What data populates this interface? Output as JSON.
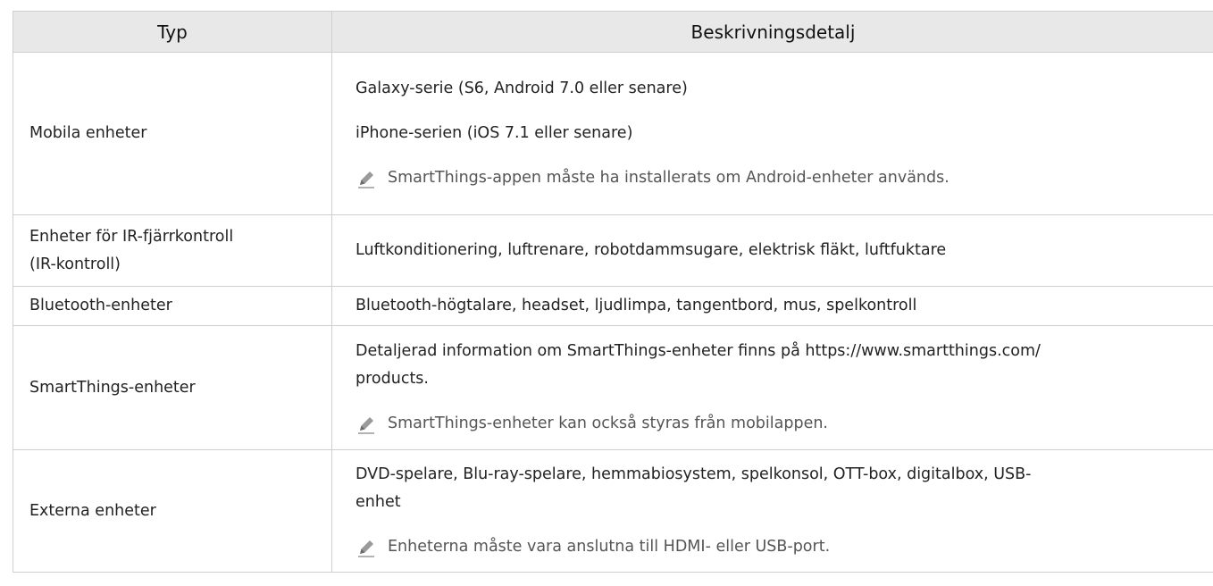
{
  "table": {
    "headers": {
      "type": "Typ",
      "description": "Beskrivningsdetalj"
    },
    "rows": [
      {
        "type": "Mobila enheter",
        "descriptions": [
          "Galaxy-serie (S6, Android 7.0 eller senare)",
          "iPhone-serien (iOS 7.1 eller senare)"
        ],
        "note": "SmartThings-appen måste ha installerats om Android-enheter används."
      },
      {
        "type_lines": [
          "Enheter för IR-fjärrkontroll",
          "(IR-kontroll)"
        ],
        "descriptions": [
          "Luftkonditionering, luftrenare, robotdammsugare, elektrisk fläkt, luftfuktare"
        ]
      },
      {
        "type": "Bluetooth-enheter",
        "descriptions": [
          "Bluetooth-högtalare, headset, ljudlimpa, tangentbord, mus, spelkontroll"
        ]
      },
      {
        "type": "SmartThings-enheter",
        "description_lines": [
          "Detaljerad information om SmartThings-enheter finns på https://www.smartthings.com/",
          "products."
        ],
        "note": "SmartThings-enheter kan också styras från mobilappen."
      },
      {
        "type": "Externa enheter",
        "description_lines": [
          "DVD-spelare, Blu-ray-spelare, hemmabiosystem, spelkonsol, OTT-box, digitalbox, USB-",
          "enhet"
        ],
        "note": "Enheterna måste vara anslutna till HDMI- eller USB-port."
      }
    ]
  },
  "icons": {
    "note": "pencil-note-icon"
  },
  "colors": {
    "header_bg": "#e8e8e8",
    "border": "#cfcfcf",
    "text": "#222222",
    "note_text": "#555555"
  }
}
